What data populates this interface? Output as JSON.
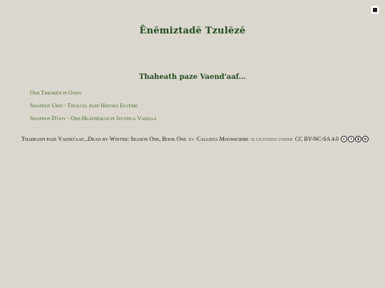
{
  "site": {
    "title": "Ēnĕmiztadĕ Tzulĕzĕ"
  },
  "book": {
    "title": "Thaheath paze Vaend'aaf..."
  },
  "chapters": [
    "Osh Theorēn pi Onen",
    "Shapdof Umō - Thulcel paze Hefoks Elvēme",
    "Shapdof D'oov - Osh Heathēmad pi Jzuthua Vaedaa"
  ],
  "license": {
    "work_title": "Thaheath paze Vaend'aaf...Dead by Winter: Season One, Book One",
    "by": "by",
    "author": "Callista Moonscribe",
    "licensed_under": "is licensed under",
    "license_name": "CC BY-NC-SA 4.0",
    "badges": [
      "cc-icon",
      "by-icon",
      "nc-icon",
      "sa-icon"
    ]
  },
  "colors": {
    "heading": "#1f4d1f",
    "link": "#3f6b1e",
    "background": "#ddd8cf"
  }
}
